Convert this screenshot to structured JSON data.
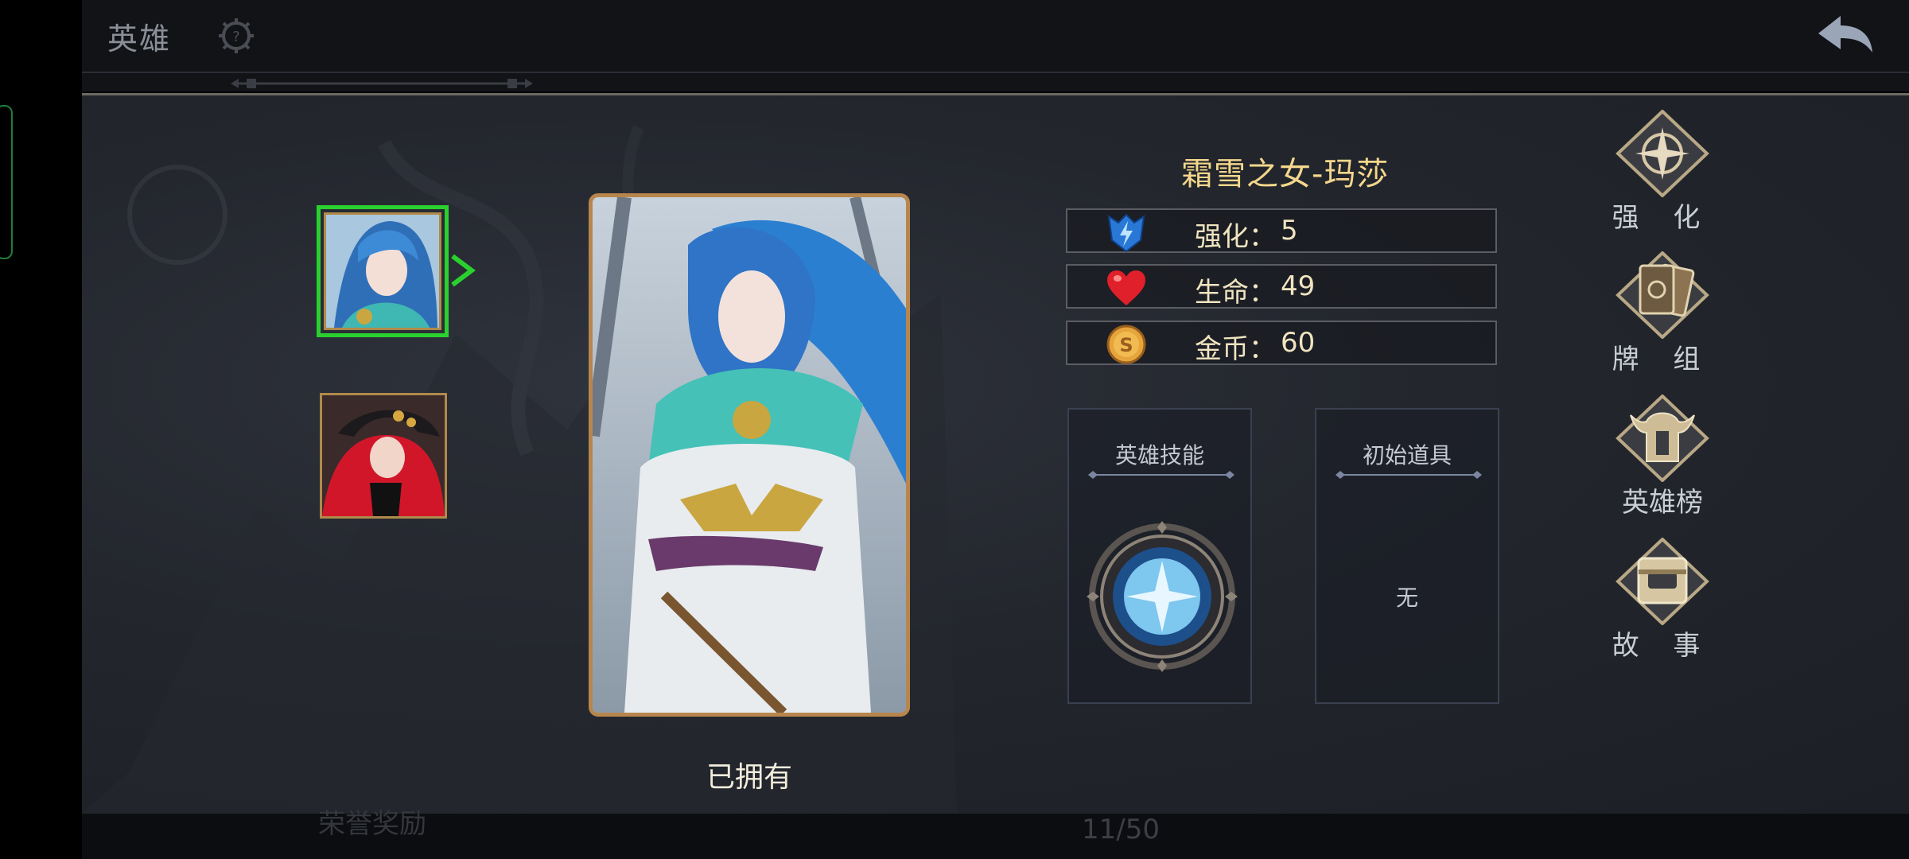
{
  "header": {
    "title": "英雄"
  },
  "hero": {
    "name": "霜雪之女-玛莎",
    "status": "已拥有"
  },
  "stats": [
    {
      "label": "强化",
      "value": "5",
      "icon": "lightning-crest-icon"
    },
    {
      "label": "生命",
      "value": "49",
      "icon": "heart-icon"
    },
    {
      "label": "金币",
      "value": "60",
      "icon": "gold-coin-icon"
    }
  ],
  "panels": {
    "skill_title": "英雄技能",
    "item_title": "初始道具",
    "item_value": "无"
  },
  "menu": [
    {
      "label": "强 化",
      "icon": "compass-star-icon"
    },
    {
      "label": "牌 组",
      "icon": "card-deck-icon"
    },
    {
      "label": "英雄榜",
      "icon": "horned-helmet-icon"
    },
    {
      "label": "故 事",
      "icon": "story-chest-icon"
    }
  ],
  "footer": {
    "page_counter": "11/50",
    "ghost_button": "荣誉奖励"
  },
  "colors": {
    "accent_gold": "#f4d78c",
    "selection_green": "#2ad12e",
    "frame_bronze": "#b8864c"
  }
}
